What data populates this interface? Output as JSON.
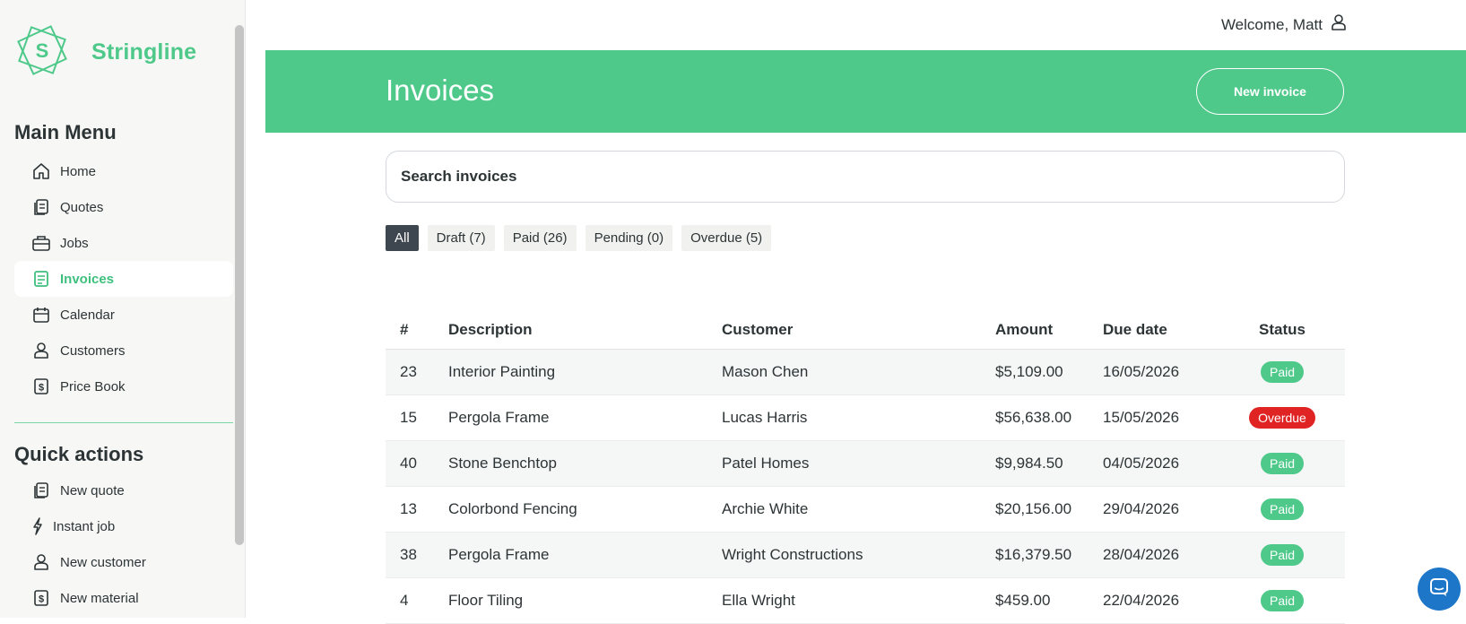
{
  "app": {
    "brand_name": "Stringline",
    "brand_color": "#4ec98a"
  },
  "topbar": {
    "welcome": "Welcome, Matt",
    "user_icon": "user-icon"
  },
  "sidebar": {
    "main_title": "Main Menu",
    "items": [
      {
        "label": "Home",
        "icon": "home-icon"
      },
      {
        "label": "Quotes",
        "icon": "quotes-icon"
      },
      {
        "label": "Jobs",
        "icon": "briefcase-icon"
      },
      {
        "label": "Invoices",
        "icon": "invoice-icon",
        "active": true
      },
      {
        "label": "Calendar",
        "icon": "calendar-icon"
      },
      {
        "label": "Customers",
        "icon": "user-icon"
      },
      {
        "label": "Price Book",
        "icon": "dollar-doc-icon"
      }
    ],
    "quick_title": "Quick actions",
    "quick_items": [
      {
        "label": "New quote",
        "icon": "quotes-icon"
      },
      {
        "label": "Instant job",
        "icon": "lightning-icon"
      },
      {
        "label": "New customer",
        "icon": "user-icon"
      },
      {
        "label": "New material",
        "icon": "dollar-doc-icon"
      }
    ]
  },
  "header": {
    "title": "Invoices",
    "new_button": "New invoice"
  },
  "search": {
    "placeholder": "Search invoices"
  },
  "filters": [
    {
      "label": "All",
      "active": true
    },
    {
      "label": "Draft (7)"
    },
    {
      "label": "Paid (26)"
    },
    {
      "label": "Pending (0)"
    },
    {
      "label": "Overdue (5)"
    }
  ],
  "table": {
    "columns": [
      "#",
      "Description",
      "Customer",
      "Amount",
      "Due date",
      "Status"
    ],
    "rows": [
      {
        "num": "23",
        "desc": "Interior Painting",
        "customer": "Mason Chen",
        "amount": "$5,109.00",
        "due": "16/05/2026",
        "status": "Paid"
      },
      {
        "num": "15",
        "desc": "Pergola Frame",
        "customer": "Lucas Harris",
        "amount": "$56,638.00",
        "due": "15/05/2026",
        "status": "Overdue"
      },
      {
        "num": "40",
        "desc": "Stone Benchtop",
        "customer": "Patel Homes",
        "amount": "$9,984.50",
        "due": "04/05/2026",
        "status": "Paid"
      },
      {
        "num": "13",
        "desc": "Colorbond Fencing",
        "customer": "Archie White",
        "amount": "$20,156.00",
        "due": "29/04/2026",
        "status": "Paid"
      },
      {
        "num": "38",
        "desc": "Pergola Frame",
        "customer": "Wright Constructions",
        "amount": "$16,379.50",
        "due": "28/04/2026",
        "status": "Paid"
      },
      {
        "num": "4",
        "desc": "Floor Tiling",
        "customer": "Ella Wright",
        "amount": "$459.00",
        "due": "22/04/2026",
        "status": "Paid"
      }
    ]
  },
  "status_colors": {
    "Paid": "#4ec98a",
    "Overdue": "#e02424"
  },
  "chat": {
    "icon": "chat-icon",
    "color": "#1e76c9"
  }
}
